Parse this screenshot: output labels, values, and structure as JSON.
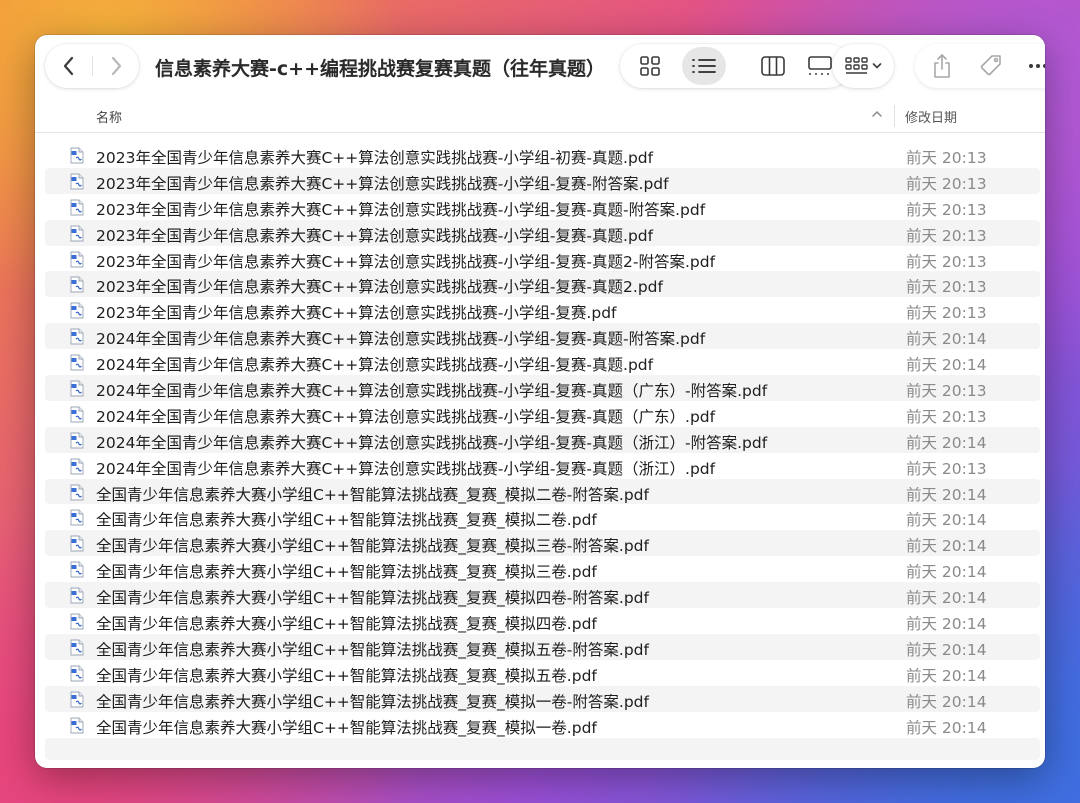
{
  "window": {
    "title": "信息素养大赛-c++编程挑战赛复赛真题（往年真题）"
  },
  "toolbar": {
    "back_icon": "chevron-left-icon",
    "forward_icon": "chevron-right-icon",
    "views": [
      "grid-view-icon",
      "list-view-icon",
      "column-view-icon",
      "gallery-view-icon"
    ],
    "active_view": "list",
    "group_icon": "group-by-icon",
    "share_icon": "share-icon",
    "tag_icon": "tag-icon",
    "more_icon": "more-icon"
  },
  "columns": {
    "name": "名称",
    "date": "修改日期"
  },
  "files": [
    {
      "name": "2023年全国青少年信息素养大赛C++算法创意实践挑战赛-小学组-初赛-真题.pdf",
      "date": "前天 20:13"
    },
    {
      "name": "2023年全国青少年信息素养大赛C++算法创意实践挑战赛-小学组-复赛-附答案.pdf",
      "date": "前天 20:13"
    },
    {
      "name": "2023年全国青少年信息素养大赛C++算法创意实践挑战赛-小学组-复赛-真题-附答案.pdf",
      "date": "前天 20:13"
    },
    {
      "name": "2023年全国青少年信息素养大赛C++算法创意实践挑战赛-小学组-复赛-真题.pdf",
      "date": "前天 20:13"
    },
    {
      "name": "2023年全国青少年信息素养大赛C++算法创意实践挑战赛-小学组-复赛-真题2-附答案.pdf",
      "date": "前天 20:13"
    },
    {
      "name": "2023年全国青少年信息素养大赛C++算法创意实践挑战赛-小学组-复赛-真题2.pdf",
      "date": "前天 20:13"
    },
    {
      "name": "2023年全国青少年信息素养大赛C++算法创意实践挑战赛-小学组-复赛.pdf",
      "date": "前天 20:13"
    },
    {
      "name": "2024年全国青少年信息素养大赛C++算法创意实践挑战赛-小学组-复赛-真题-附答案.pdf",
      "date": "前天 20:14"
    },
    {
      "name": "2024年全国青少年信息素养大赛C++算法创意实践挑战赛-小学组-复赛-真题.pdf",
      "date": "前天 20:14"
    },
    {
      "name": "2024年全国青少年信息素养大赛C++算法创意实践挑战赛-小学组-复赛-真题（广东）-附答案.pdf",
      "date": "前天 20:13"
    },
    {
      "name": "2024年全国青少年信息素养大赛C++算法创意实践挑战赛-小学组-复赛-真题（广东）.pdf",
      "date": "前天 20:13"
    },
    {
      "name": "2024年全国青少年信息素养大赛C++算法创意实践挑战赛-小学组-复赛-真题（浙江）-附答案.pdf",
      "date": "前天 20:14"
    },
    {
      "name": "2024年全国青少年信息素养大赛C++算法创意实践挑战赛-小学组-复赛-真题（浙江）.pdf",
      "date": "前天 20:13"
    },
    {
      "name": "全国青少年信息素养大赛小学组C++智能算法挑战赛_复赛_模拟二卷-附答案.pdf",
      "date": "前天 20:14"
    },
    {
      "name": "全国青少年信息素养大赛小学组C++智能算法挑战赛_复赛_模拟二卷.pdf",
      "date": "前天 20:14"
    },
    {
      "name": "全国青少年信息素养大赛小学组C++智能算法挑战赛_复赛_模拟三卷-附答案.pdf",
      "date": "前天 20:14"
    },
    {
      "name": "全国青少年信息素养大赛小学组C++智能算法挑战赛_复赛_模拟三卷.pdf",
      "date": "前天 20:14"
    },
    {
      "name": "全国青少年信息素养大赛小学组C++智能算法挑战赛_复赛_模拟四卷-附答案.pdf",
      "date": "前天 20:14"
    },
    {
      "name": "全国青少年信息素养大赛小学组C++智能算法挑战赛_复赛_模拟四卷.pdf",
      "date": "前天 20:14"
    },
    {
      "name": "全国青少年信息素养大赛小学组C++智能算法挑战赛_复赛_模拟五卷-附答案.pdf",
      "date": "前天 20:14"
    },
    {
      "name": "全国青少年信息素养大赛小学组C++智能算法挑战赛_复赛_模拟五卷.pdf",
      "date": "前天 20:14"
    },
    {
      "name": "全国青少年信息素养大赛小学组C++智能算法挑战赛_复赛_模拟一卷-附答案.pdf",
      "date": "前天 20:14"
    },
    {
      "name": "全国青少年信息素养大赛小学组C++智能算法挑战赛_复赛_模拟一卷.pdf",
      "date": "前天 20:14"
    }
  ],
  "file_icon": "pdf-file-icon"
}
